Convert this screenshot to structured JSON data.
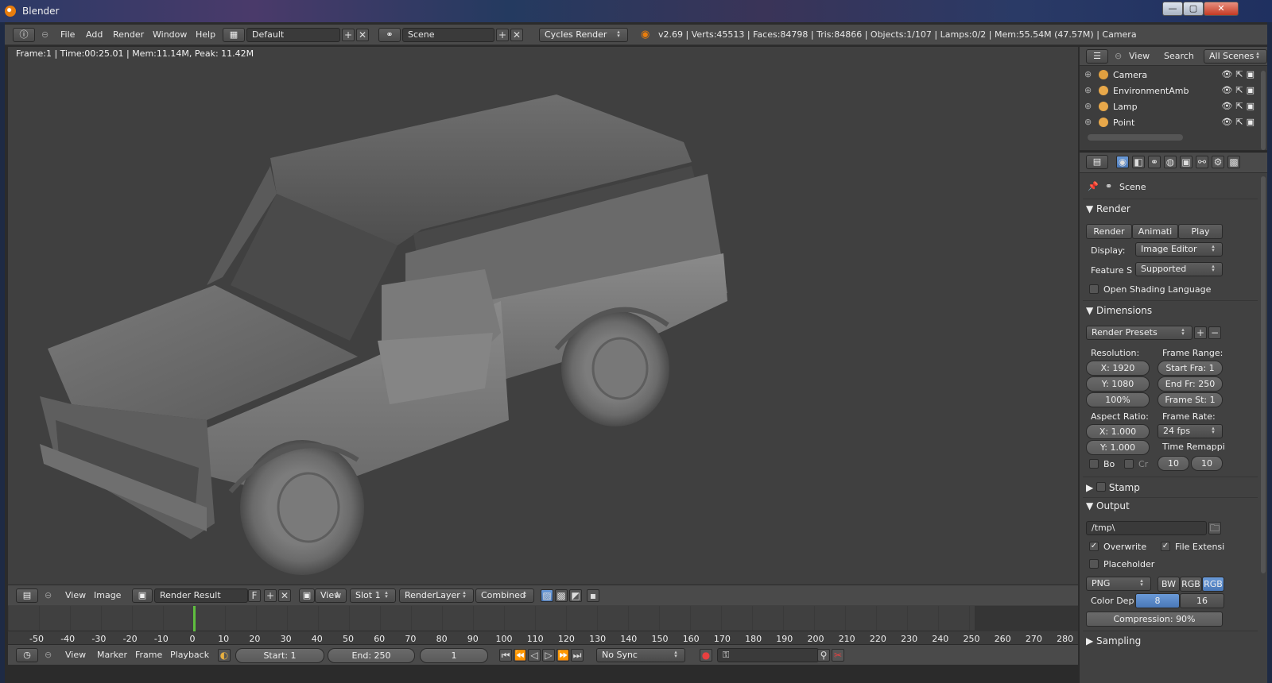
{
  "window": {
    "title": "Blender",
    "controls": {
      "minimize": "—",
      "maximize": "▢",
      "close": "✕"
    }
  },
  "topbar": {
    "menu": [
      "File",
      "Add",
      "Render",
      "Window",
      "Help"
    ],
    "screen": "Default",
    "scene": "Scene",
    "engine": "Cycles Render",
    "stats": "v2.69 | Verts:45513 | Faces:84798 | Tris:84866 | Objects:1/107 | Lamps:0/2 | Mem:55.54M (47.57M) | Camera"
  },
  "viewport": {
    "render_info": "Frame:1 | Time:00:25.01 | Mem:11.14M, Peak: 11.42M"
  },
  "image_editor": {
    "menu": [
      "View",
      "Image"
    ],
    "image": "Render Result",
    "fake_user": "F",
    "view": "View",
    "slot": "Slot 1",
    "layer": "RenderLayer",
    "pass": "Combined"
  },
  "timeline": {
    "current_frame": 1,
    "ticks": [
      "-50",
      "-40",
      "-30",
      "-20",
      "-10",
      "0",
      "10",
      "20",
      "30",
      "40",
      "50",
      "60",
      "70",
      "80",
      "90",
      "100",
      "110",
      "120",
      "130",
      "140",
      "150",
      "160",
      "170",
      "180",
      "190",
      "200",
      "210",
      "220",
      "230",
      "240",
      "250",
      "260",
      "270",
      "280"
    ],
    "menu": [
      "View",
      "Marker",
      "Frame",
      "Playback"
    ],
    "start": "Start: 1",
    "end": "End: 250",
    "frame": "1",
    "sync": "No Sync"
  },
  "outliner": {
    "menu": [
      "View",
      "Search"
    ],
    "filter": "All Scenes",
    "items": [
      {
        "name": "Camera"
      },
      {
        "name": "EnvironmentAmb"
      },
      {
        "name": "Lamp"
      },
      {
        "name": "Point"
      }
    ]
  },
  "properties": {
    "scene": "Scene",
    "render": {
      "title": "Render",
      "buttons": [
        "Render",
        "Animati",
        "Play"
      ],
      "display_label": "Display:",
      "display_value": "Image Editor",
      "feature_label": "Feature S",
      "feature_value": "Supported",
      "osl_label": "Open Shading Language"
    },
    "dimensions": {
      "title": "Dimensions",
      "presets": "Render Presets",
      "resolution_label": "Resolution:",
      "res_x": "X: 1920",
      "res_y": "Y: 1080",
      "res_pct": "100%",
      "frame_range_label": "Frame Range:",
      "start": "Start Fra: 1",
      "end": "End Fr: 250",
      "step": "Frame St: 1",
      "aspect_label": "Aspect Ratio:",
      "aspect_x": "X: 1.000",
      "aspect_y": "Y: 1.000",
      "frame_rate_label": "Frame Rate:",
      "frame_rate": "24 fps",
      "time_remap_label": "Time Remappi",
      "remap_old": "10",
      "remap_new": "10",
      "border_label": "Bo",
      "crop_label": "Cr"
    },
    "stamp": {
      "title": "Stamp"
    },
    "output": {
      "title": "Output",
      "path": "/tmp\\",
      "overwrite": "Overwrite",
      "file_ext": "File Extensi",
      "placeholder": "Placeholder",
      "format": "PNG",
      "modes": [
        "BW",
        "RGB",
        "RGB"
      ],
      "color_depth_label": "Color Dep",
      "depths": [
        "8",
        "16"
      ],
      "compression": "Compression: 90%"
    },
    "sampling": {
      "title": "Sampling"
    }
  },
  "colors": {
    "accent": "#5b8bd0",
    "frame_cursor": "#5fbf3f",
    "viewport_bg": "#404040"
  }
}
